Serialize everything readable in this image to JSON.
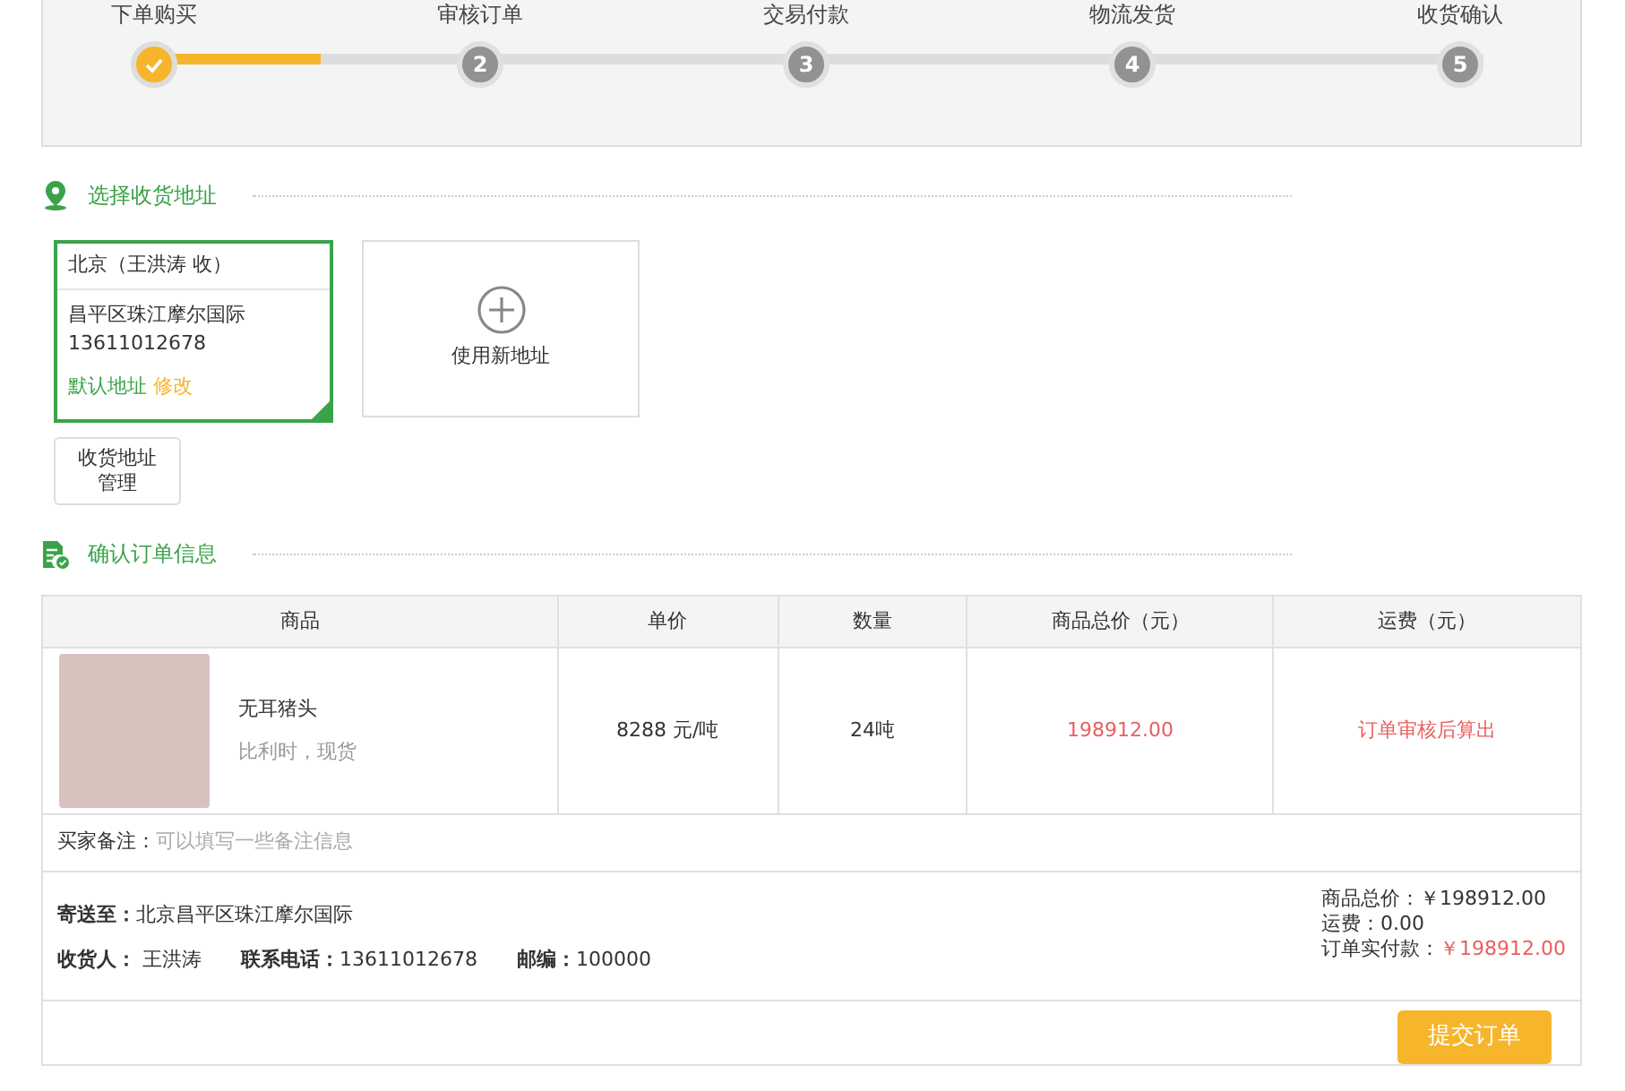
{
  "progress": {
    "level": 0.125,
    "steps": [
      {
        "label": "下单购买",
        "done": true
      },
      {
        "label": "审核订单",
        "number": "2",
        "done": false
      },
      {
        "label": "交易付款",
        "number": "3",
        "done": false
      },
      {
        "label": "物流发货",
        "number": "4",
        "done": false
      },
      {
        "label": "收货确认",
        "number": "5",
        "done": false
      }
    ]
  },
  "address_section": {
    "title": "选择收货地址",
    "addresses": [
      {
        "title": "北京（王洪涛 收）",
        "street": "昌平区珠江摩尔国际",
        "phone": "13611012678",
        "default_label": "默认地址",
        "edit_link": "修改",
        "selected": true
      }
    ],
    "new_address": {
      "label": "使用新地址"
    },
    "manage_button": "收货地址管理"
  },
  "order_section": {
    "title": "确认订单信息",
    "table": {
      "columns": [
        "商品",
        "单价",
        "数量",
        "商品总价（元）",
        "运费（元）"
      ],
      "rows": [
        {
          "name": "无耳猪头",
          "note": "比利时，现货",
          "unit_price": "8288 元/吨",
          "quantity": "24吨",
          "total": "198912.00",
          "shipping": "订单审核后算出"
        }
      ]
    },
    "remark": {
      "label": "买家备注：",
      "placeholder": "可以填写一些备注信息"
    },
    "delivery": {
      "ship_to": "**寄送至：**北京昌平区珠江摩尔国际",
      "receiver": "**收货人：** 王洪涛",
      "phone": "**联系电话：**13611012678",
      "zip": "**邮编：**100000"
    },
    "summary": {
      "goods_total": "商品总价：￥198912.00",
      "shipping": "运费：0.00",
      "paid_label": "订单实付款：",
      "paid_value": "￥198912.00"
    },
    "submit_button": "提交订单"
  }
}
